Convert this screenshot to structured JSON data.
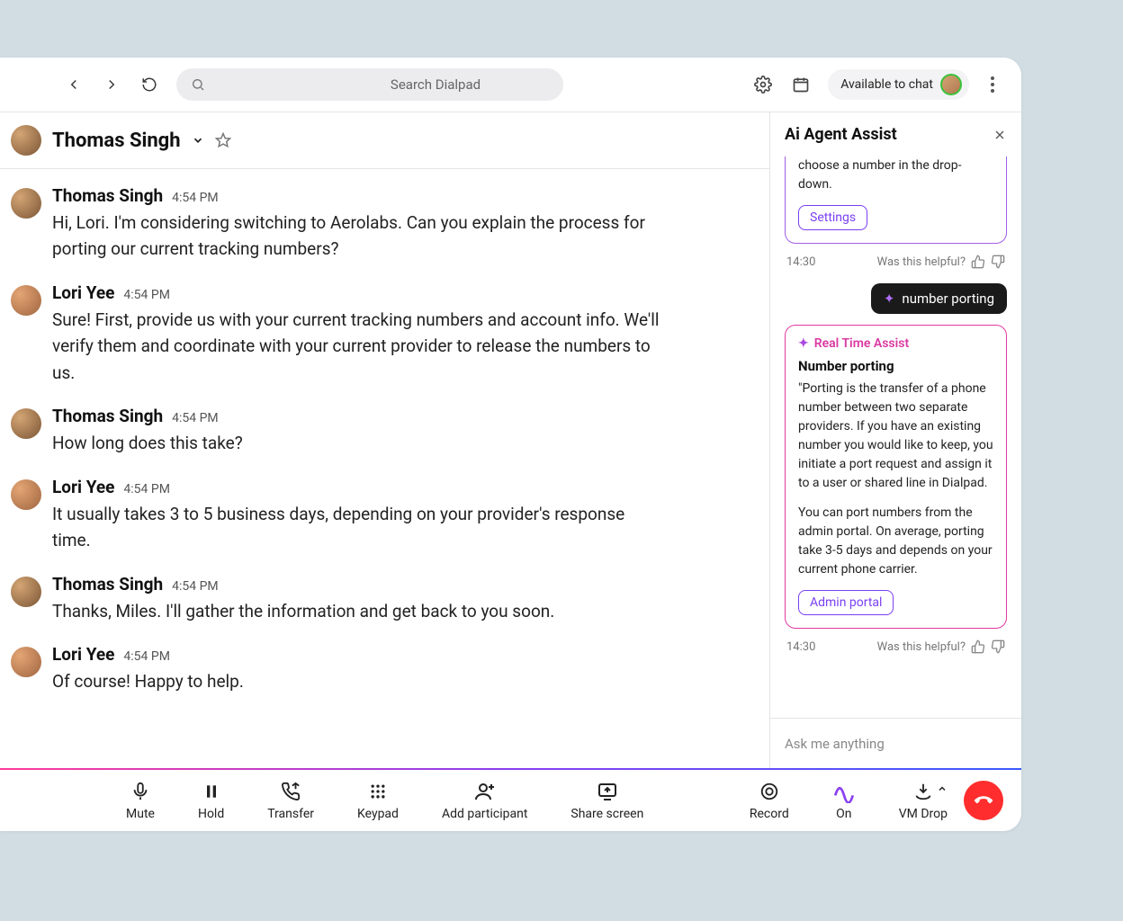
{
  "toolbar": {
    "search_placeholder": "Search Dialpad",
    "status_label": "Available to chat"
  },
  "contact": {
    "name": "Thomas Singh"
  },
  "messages": [
    {
      "author": "Thomas Singh",
      "avatar": "thomas",
      "time": "4:54 PM",
      "body": "Hi, Lori. I'm considering switching to Aerolabs. Can you explain the process for porting our current tracking numbers?"
    },
    {
      "author": "Lori Yee",
      "avatar": "lori",
      "time": "4:54 PM",
      "body": "Sure! First, provide us with your current tracking numbers and account info. We'll verify them and coordinate with your current provider to release the numbers to us."
    },
    {
      "author": "Thomas Singh",
      "avatar": "thomas",
      "time": "4:54 PM",
      "body": "How long does this take?"
    },
    {
      "author": "Lori Yee",
      "avatar": "lori",
      "time": "4:54 PM",
      "body": "It usually takes 3 to 5 business days, depending on your provider's response time."
    },
    {
      "author": "Thomas Singh",
      "avatar": "thomas",
      "time": "4:54 PM",
      "body": "Thanks, Miles. I'll gather the information and get back to you soon."
    },
    {
      "author": "Lori Yee",
      "avatar": "lori",
      "time": "4:54 PM",
      "body": "Of course! Happy to help."
    }
  ],
  "assist": {
    "title": "Ai Agent Assist",
    "prev_card": {
      "snippet": "choose a number in the drop-down.",
      "button": "Settings",
      "time": "14:30",
      "helpful_label": "Was this helpful?"
    },
    "user_query": "number porting",
    "card": {
      "label": "Real Time Assist",
      "heading": "Number porting",
      "para1": "\"Porting is the transfer of a phone number between two separate providers. If you have an existing number you would like to keep, you initiate a port request and assign it to a user or shared line in Dialpad.",
      "para2": "You can port numbers from the admin portal. On average, porting take 3-5 days and depends on your current phone carrier.",
      "button": "Admin portal",
      "time": "14:30",
      "helpful_label": "Was this helpful?"
    },
    "input_placeholder": "Ask me anything"
  },
  "callbar": {
    "mute": "Mute",
    "hold": "Hold",
    "transfer": "Transfer",
    "keypad": "Keypad",
    "add_participant": "Add participant",
    "share_screen": "Share screen",
    "record": "Record",
    "ai_on": "On",
    "vm_drop": "VM Drop"
  }
}
